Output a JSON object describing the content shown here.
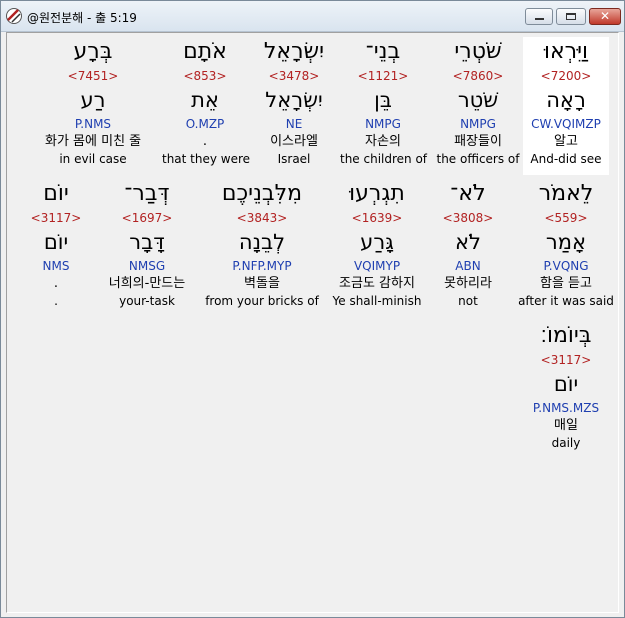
{
  "window": {
    "title": "@원전분해 - 출 5:19"
  },
  "words": [
    {
      "hebrew": "וַיִּרְאוּ",
      "strong": "<7200>",
      "lemma": "רָאָה",
      "morph": "CW.VQIMZP",
      "korean": "알고",
      "english": "And-did see",
      "highlight": true
    },
    {
      "hebrew": "שֹׁטְרֵי",
      "strong": "<7860>",
      "lemma": "שֹׁטֵר",
      "morph": "NMPG",
      "korean": "패장들이",
      "english": "the officers of",
      "highlight": false
    },
    {
      "hebrew": "בְנֵי־",
      "strong": "<1121>",
      "lemma": "בֵּן",
      "morph": "NMPG",
      "korean": "자손의",
      "english": "the children of",
      "highlight": false
    },
    {
      "hebrew": "יִשְׂרָאֵל",
      "strong": "<3478>",
      "lemma": "יִשְׂרָאֵל",
      "morph": "NE",
      "korean": "이스라엘",
      "english": "Israel",
      "highlight": false
    },
    {
      "hebrew": "אֹתָם",
      "strong": "<853>",
      "lemma": "אֵת",
      "morph": "O.MZP",
      "korean": ".",
      "english": "that they were",
      "highlight": false
    },
    {
      "hebrew": "בְּרָע",
      "strong": "<7451>",
      "lemma": "רַע",
      "morph": "P.NMS",
      "korean": "화가 몸에 미친 줄",
      "english": "in evil case",
      "highlight": false
    },
    {
      "hebrew": "לֵאמֹר",
      "strong": "<559>",
      "lemma": "אָמַר",
      "morph": "P.VQNG",
      "korean": "함을 듣고",
      "english": "after it was said",
      "highlight": false
    },
    {
      "hebrew": "לֹא־",
      "strong": "<3808>",
      "lemma": "לֹא",
      "morph": "ABN",
      "korean": "못하리라",
      "english": "not",
      "highlight": false
    },
    {
      "hebrew": "תִגְרְעוּ",
      "strong": "<1639>",
      "lemma": "גָּרַע",
      "morph": "VQIMYP",
      "korean": "조금도 감하지",
      "english": "Ye shall-minish",
      "highlight": false
    },
    {
      "hebrew": "מִלִּבְנֵיכֶם",
      "strong": "<3843>",
      "lemma": "לְבֵנָה",
      "morph": "P.NFP.MYP",
      "korean": "벽돌을",
      "english": "from your bricks of",
      "highlight": false
    },
    {
      "hebrew": "דְּבַר־",
      "strong": "<1697>",
      "lemma": "דָּבָר",
      "morph": "NMSG",
      "korean": "너희의-만드는",
      "english": "your-task",
      "highlight": false
    },
    {
      "hebrew": "יוֹם",
      "strong": "<3117>",
      "lemma": "יוֹם",
      "morph": "NMS",
      "korean": ".",
      "english": ".",
      "highlight": false
    },
    {
      "hebrew": "בְּיוֹמוֹ׃",
      "strong": "<3117>",
      "lemma": "יוֹם",
      "morph": "P.NMS.MZS",
      "korean": "매일",
      "english": "daily",
      "highlight": false
    }
  ]
}
